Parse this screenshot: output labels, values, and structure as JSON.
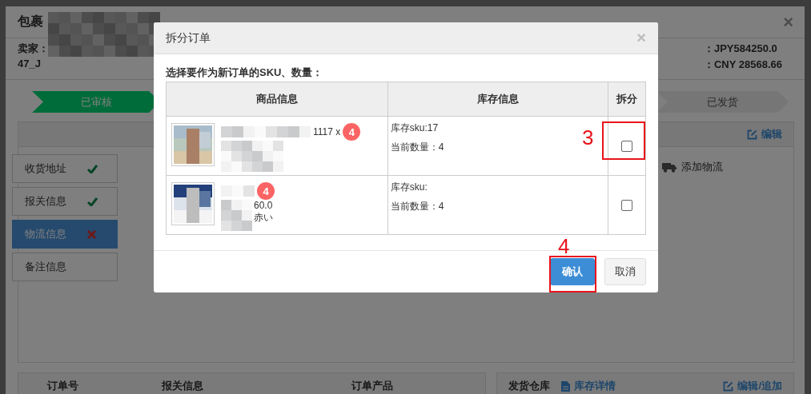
{
  "background_window": {
    "title": "包裹",
    "close": "×",
    "seller_label": "卖家：",
    "seller_id": "47_J",
    "amount": "：JPY584250.0",
    "amount_cny": "：CNY 28568.66"
  },
  "steps": [
    {
      "label": "已审核",
      "done": true
    },
    {
      "label": "已发货",
      "done": false
    }
  ],
  "panel": {
    "edit": "编辑",
    "add_logistics": "添加物流",
    "nav": [
      {
        "label": "收货地址",
        "kind": "complete",
        "selected": false
      },
      {
        "label": "报关信息",
        "kind": "complete",
        "selected": false
      },
      {
        "label": "物流信息",
        "kind": "error",
        "selected": true
      },
      {
        "label": "备注信息",
        "kind": "plain",
        "selected": false
      }
    ]
  },
  "orders_table": {
    "columns": [
      "订单号",
      "报关信息",
      "订单产品"
    ]
  },
  "warehouse": {
    "title": "发货仓库",
    "stock_link": "库存详情",
    "edit": "编辑/追加"
  },
  "dialog": {
    "title": "拆分订单",
    "close": "×",
    "prompt": "选择要作为新订单的SKU、数量：",
    "columns": [
      "商品信息",
      "库存信息",
      "拆分"
    ],
    "rows": [
      {
        "product_text": "1117 x",
        "quantity": "4",
        "stock_sku": "库存sku:17",
        "current_qty": "当前数量：4",
        "checked": false
      },
      {
        "quantity": "4",
        "lines": [
          "60.0",
          "赤い"
        ],
        "stock_sku": "库存sku:",
        "current_qty": "当前数量：4",
        "checked": false
      }
    ],
    "buttons": [
      {
        "label": "确认",
        "kind": "primary"
      },
      {
        "label": "取消",
        "kind": "default"
      }
    ],
    "annotations": [
      {
        "label": "3"
      },
      {
        "label": "4"
      }
    ]
  }
}
